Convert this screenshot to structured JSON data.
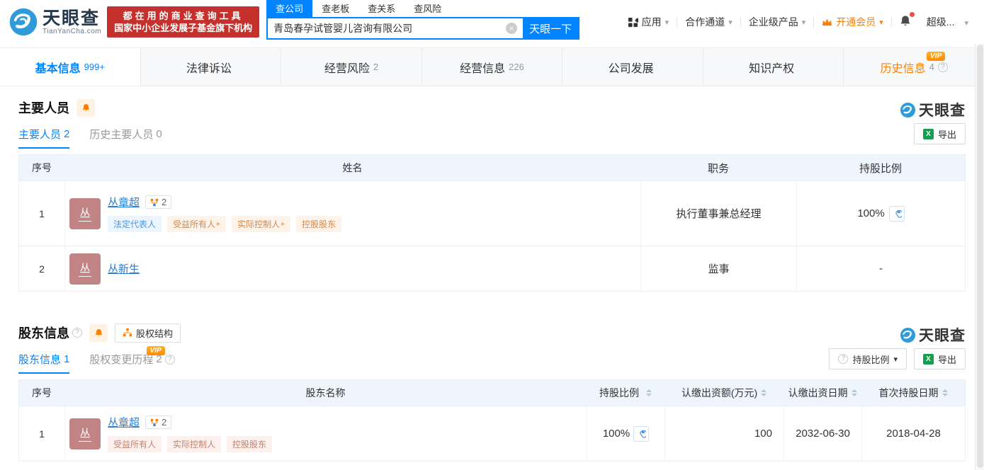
{
  "colors": {
    "accent": "#0084ff",
    "vip_orange": "#ff8000",
    "banner_red": "#c5302c",
    "link_blue": "#2a7dd2",
    "avatar_bg": "#c28384"
  },
  "icons": {
    "caret_down": "▾",
    "clear": "×",
    "tag_arrow": "▸",
    "help": "?",
    "excel_x": "X"
  },
  "header": {
    "brand": "天眼查",
    "brand_domain": "TianYanCha.com",
    "banner_line1": "都在用的商业查询工具",
    "banner_line2": "国家中小企业发展子基金旗下机构",
    "search_tabs": [
      "查公司",
      "查老板",
      "查关系",
      "查风险"
    ],
    "search_value": "青岛春孕试管婴儿咨询有限公司",
    "search_button": "天眼一下",
    "nav_app": "应用",
    "nav_coop": "合作通道",
    "nav_enterprise": "企业级产品",
    "nav_vip": "开通会员",
    "nav_super": "超级..."
  },
  "tab_bar": {
    "tabs": [
      {
        "label": "基本信息",
        "count": "999+"
      },
      {
        "label": "法律诉讼",
        "count": ""
      },
      {
        "label": "经营风险",
        "count": "2"
      },
      {
        "label": "经营信息",
        "count": "226"
      },
      {
        "label": "公司发展",
        "count": ""
      },
      {
        "label": "知识产权",
        "count": ""
      },
      {
        "label": "历史信息",
        "count": "4"
      }
    ],
    "vip_badge": "VIP"
  },
  "staff_section": {
    "title": "主要人员",
    "watermark": "天眼查",
    "tab_current_label": "主要人员",
    "tab_current_count": "2",
    "tab_history_label": "历史主要人员",
    "tab_history_count": "0",
    "export_label": "导出",
    "col_index": "序号",
    "col_name": "姓名",
    "col_position": "职务",
    "col_ratio": "持股比例",
    "rows": [
      {
        "index": "1",
        "avatar": "丛",
        "name": "丛章超",
        "badge_count": "2",
        "tag_legal": "法定代表人",
        "tag_beneficiary": "受益所有人",
        "tag_controller": "实际控制人",
        "tag_holding": "控股股东",
        "position": "执行董事兼总经理",
        "ratio": "100%"
      },
      {
        "index": "2",
        "avatar": "丛",
        "name": "丛新生",
        "position": "监事",
        "ratio": "-"
      }
    ]
  },
  "shareholder_section": {
    "title": "股东信息",
    "watermark": "天眼查",
    "equity_structure_label": "股权结构",
    "tab_info_label": "股东信息",
    "tab_info_count": "1",
    "tab_change_label": "股权变更历程",
    "tab_change_count": "2",
    "vip_badge": "VIP",
    "ratio_filter_label": "持股比例",
    "export_label": "导出",
    "col_index": "序号",
    "col_name": "股东名称",
    "col_ratio": "持股比例",
    "col_amount": "认缴出资额(万元)",
    "col_date": "认缴出资日期",
    "col_first_date": "首次持股日期",
    "rows": [
      {
        "index": "1",
        "avatar": "丛",
        "name": "丛章超",
        "badge_count": "2",
        "tag_beneficiary": "受益所有人",
        "tag_controller": "实际控制人",
        "tag_holding": "控股股东",
        "ratio": "100%",
        "amount": "100",
        "date": "2032-06-30",
        "first_date": "2018-04-28"
      }
    ]
  }
}
